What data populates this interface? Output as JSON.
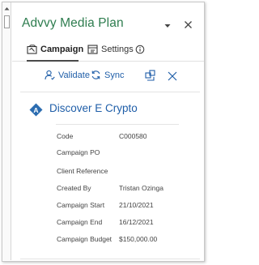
{
  "app": {
    "title": "Advvy Media Plan"
  },
  "tabs": [
    {
      "label": "Campaign",
      "icon": "campaign-icon",
      "active": true
    },
    {
      "label": "Settings",
      "icon": "settings-icon",
      "active": false
    },
    {
      "label": "",
      "icon": "info-icon",
      "active": false
    }
  ],
  "toolbar": {
    "validate_label": "Validate",
    "sync_label": "Sync",
    "export_icon": "export-icon",
    "close_icon": "close-icon"
  },
  "campaign": {
    "badge_letter": "A",
    "name": "Discover E Crypto"
  },
  "details": [
    {
      "label": "Code",
      "value": "C000580"
    },
    {
      "label": "Campaign PO",
      "value": ""
    },
    {
      "label": "Client Reference",
      "value": ""
    },
    {
      "label": "Created By",
      "value": "Tristan Ozinga"
    },
    {
      "label": "Campaign Start",
      "value": "21/10/2021"
    },
    {
      "label": "Campaign End",
      "value": "16/12/2021"
    },
    {
      "label": "Campaign Budget",
      "value": "$150,000.00"
    }
  ],
  "colors": {
    "title_green": "#2e7d4f",
    "link_blue": "#1f5ea8",
    "badge_blue": "#2b6cb0"
  }
}
